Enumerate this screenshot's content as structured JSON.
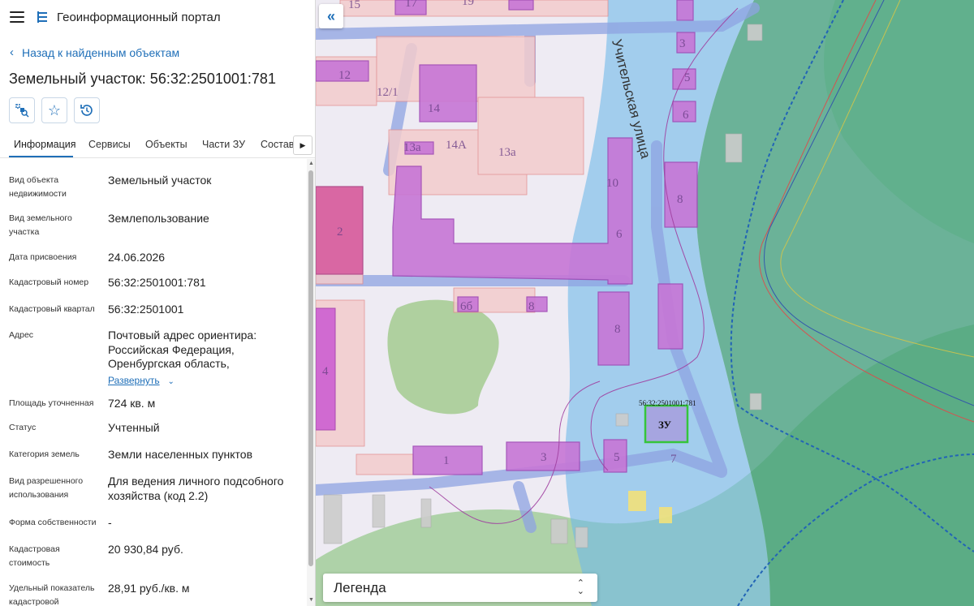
{
  "app": {
    "title": "Геоинформационный портал"
  },
  "nav": {
    "back_label": "Назад к найденным объектам"
  },
  "object": {
    "title": "Земельный участок: 56:32:2501001:781"
  },
  "tabs": [
    {
      "label": "Информация",
      "active": true
    },
    {
      "label": "Сервисы"
    },
    {
      "label": "Объекты"
    },
    {
      "label": "Части ЗУ"
    },
    {
      "label": "Состав"
    }
  ],
  "properties": [
    {
      "label": "Вид объекта недвижимости",
      "value": "Земельный участок"
    },
    {
      "label": "Вид земельного участка",
      "value": "Землепользование"
    },
    {
      "label": "Дата присвоения",
      "value": "24.06.2026"
    },
    {
      "label": "Кадастровый номер",
      "value": "56:32:2501001:781"
    },
    {
      "label": "Кадастровый квартал",
      "value": "56:32:2501001"
    },
    {
      "label": "Адрес",
      "value": "Почтовый адрес ориентира: Российская Федерация, Оренбургская область,",
      "expand_label": "Развернуть"
    },
    {
      "label": "Площадь уточненная",
      "value": "724 кв. м"
    },
    {
      "label": "Статус",
      "value": "Учтенный"
    },
    {
      "label": "Категория земель",
      "value": "Земли населенных пунктов"
    },
    {
      "label": "Вид разрешенного использования",
      "value": "Для ведения личного подсобного хозяйства (код 2.2)"
    },
    {
      "label": "Форма собственности",
      "value": "-"
    },
    {
      "label": "Кадастровая стоимость",
      "value": "20 930,84 руб."
    },
    {
      "label": "Удельный показатель кадастровой",
      "value": "28,91 руб./кв. м"
    }
  ],
  "map": {
    "street_label": "Учительская улица",
    "parcel_label": "56:32:2501001:781",
    "parcel_code": "ЗУ",
    "building_numbers": [
      "15",
      "17",
      "19",
      "12",
      "12/1",
      "14",
      "14А",
      "13а",
      "3",
      "5",
      "6",
      "10",
      "8",
      "2",
      "4",
      "6б",
      "1",
      "3",
      "5",
      "7",
      "8",
      "6",
      "8",
      "13"
    ],
    "legend_label": "Легенда"
  },
  "colors": {
    "accent": "#1f6fb8",
    "parcel_outline": "#35c53a"
  },
  "icons": {
    "menu": "menu-icon",
    "logo": "portal-logo-icon",
    "back": "chevron-left-icon",
    "collapse": "double-chevron-left-icon"
  }
}
